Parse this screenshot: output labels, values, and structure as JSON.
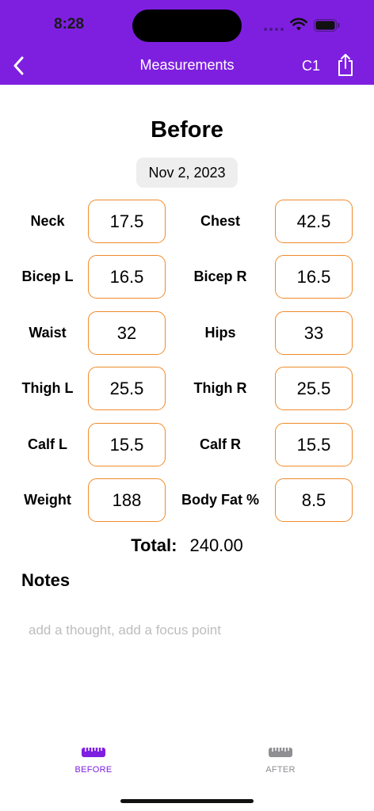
{
  "status_bar": {
    "time": "8:28"
  },
  "nav": {
    "title": "Measurements",
    "profile_label": "C1"
  },
  "page": {
    "heading": "Before",
    "date": "Nov 2, 2023"
  },
  "measurements": [
    {
      "left_label": "Neck",
      "left_value": "17.5",
      "right_label": "Chest",
      "right_value": "42.5"
    },
    {
      "left_label": "Bicep L",
      "left_value": "16.5",
      "right_label": "Bicep R",
      "right_value": "16.5"
    },
    {
      "left_label": "Waist",
      "left_value": "32",
      "right_label": "Hips",
      "right_value": "33"
    },
    {
      "left_label": "Thigh L",
      "left_value": "25.5",
      "right_label": "Thigh R",
      "right_value": "25.5"
    },
    {
      "left_label": "Calf L",
      "left_value": "15.5",
      "right_label": "Calf R",
      "right_value": "15.5"
    },
    {
      "left_label": "Weight",
      "left_value": "188",
      "right_label": "Body Fat %",
      "right_value": "8.5"
    }
  ],
  "total": {
    "label": "Total:",
    "value": "240.00"
  },
  "notes": {
    "heading": "Notes",
    "placeholder": "add a thought, add a focus point"
  },
  "tabs": [
    {
      "label": "BEFORE",
      "icon": "ruler-icon",
      "active": true
    },
    {
      "label": "AFTER",
      "icon": "ruler-icon",
      "active": false
    }
  ],
  "colors": {
    "header": "#7e1fe0",
    "accent_border": "#f08a2b",
    "tab_active": "#7e1fe0",
    "tab_inactive": "#8e8e93"
  }
}
